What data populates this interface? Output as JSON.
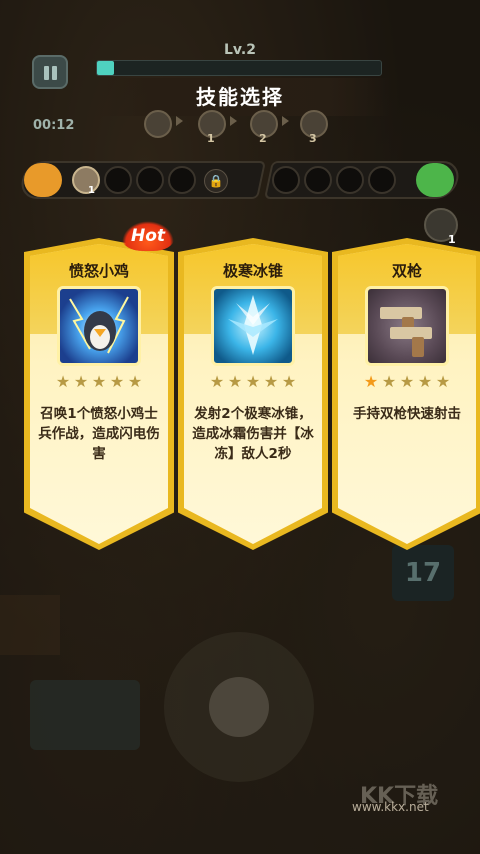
{
  "hud": {
    "level": "Lv.2",
    "time": "00:12",
    "xp_progress": 0.06,
    "title": "技能选择",
    "path_nodes": [
      "1",
      "2",
      "3"
    ]
  },
  "slot_bar": {
    "weapon_slot_count": "1",
    "side_count": "1"
  },
  "cards": [
    {
      "name": "愤怒小鸡",
      "stars_on": 0,
      "description": "召唤1个愤怒小鸡士兵作战，造成闪电伤害",
      "hot_label": "Hot"
    },
    {
      "name": "极寒冰锥",
      "stars_on": 0,
      "description": "发射2个极寒冰锥，造成冰霜伤害并【冰冻】敌人2秒"
    },
    {
      "name": "双枪",
      "stars_on": 1,
      "description": "手持双枪快速射击"
    }
  ],
  "counter": "17",
  "watermark": {
    "big": "KK下载",
    "url": "www.kkx.net"
  },
  "colors": {
    "card_border": "#e9b820",
    "star_on": "#f39a1a",
    "xp": "#4fd2c0",
    "attack": "#e89a2a",
    "defense": "#4db54a"
  }
}
